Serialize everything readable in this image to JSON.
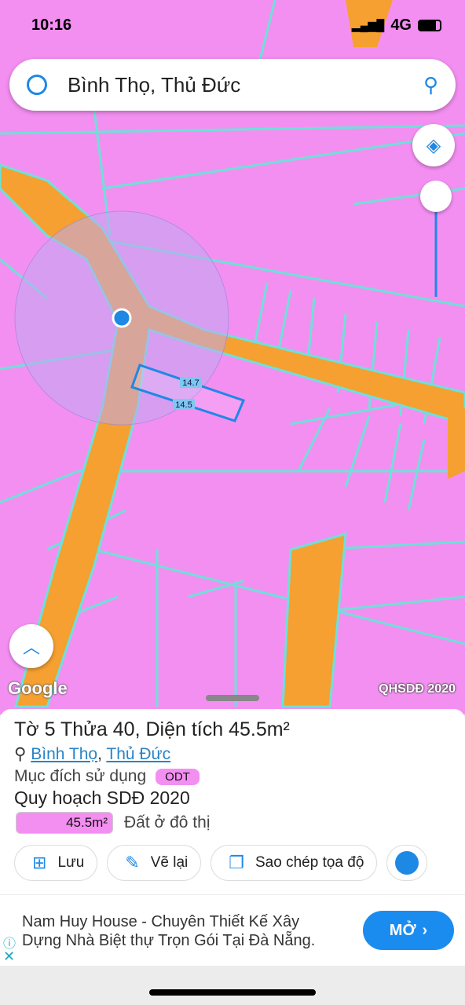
{
  "status": {
    "time": "10:16",
    "network": "4G"
  },
  "search": {
    "query": "Bình Thọ, Thủ Đức"
  },
  "map": {
    "edge_top": "14.7",
    "edge_bottom": "14.5",
    "attribution": "Google",
    "layer_label": "QHSDĐ 2020",
    "colors": {
      "residential": "#f48ff2",
      "road": "#f5a030",
      "boundary": "#6fe0d8",
      "selection": "#1e88e5"
    }
  },
  "parcel": {
    "title": "Tờ 5 Thửa 40, Diện tích 45.5m²",
    "ward": "Bình Thọ",
    "district": "Thủ Đức",
    "purpose_label": "Mục đích sử dụng",
    "purpose_code": "ODT",
    "plan_title": "Quy hoạch SDĐ 2020",
    "plan_area": "45.5m²",
    "plan_type": "Đất ở đô thị"
  },
  "actions": [
    {
      "label": "Lưu",
      "icon": "save-file-icon"
    },
    {
      "label": "Vẽ lại",
      "icon": "redraw-icon"
    },
    {
      "label": "Sao chép tọa độ",
      "icon": "copy-icon"
    }
  ],
  "ad": {
    "text": "Nam Huy House - Chuyên Thiết Kế Xây Dựng Nhà Biệt thự Trọn Gói Tại Đà Nẵng.",
    "button": "MỞ"
  }
}
